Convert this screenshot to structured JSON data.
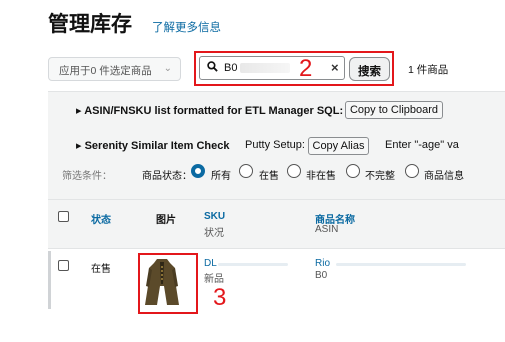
{
  "page": {
    "title": "管理库存",
    "learn_more": "了解更多信息"
  },
  "toolbar": {
    "bulk_action": "应用于0 件选定商品",
    "search_value": "B0",
    "search_button": "搜索",
    "result_count": "1 件商品"
  },
  "annotations": {
    "search_marker": "2",
    "image_marker": "3",
    "color": "#e3171b"
  },
  "tools": {
    "asin_list_label": "ASIN/FNSKU list formatted for ETL Manager SQL:",
    "copy_clipboard": "Copy to Clipboard",
    "serenity_label": "Serenity Similar Item Check",
    "putty_label": "Putty Setup:",
    "copy_alias": "Copy Alias",
    "age_hint": "Enter \"-age\" va"
  },
  "filters": {
    "label": "筛选条件：",
    "status_label": "商品状态：",
    "options": [
      "所有",
      "在售",
      "非在售",
      "不完整",
      "商品信息"
    ],
    "selected": "所有"
  },
  "table": {
    "headers": {
      "status": "状态",
      "image": "图片",
      "sku": "SKU",
      "condition": "状况",
      "name": "商品名称",
      "asin": "ASIN"
    },
    "rows": [
      {
        "status": "在售",
        "sku": "DL",
        "condition": "新品",
        "name": "Rio",
        "asin": "B0"
      }
    ]
  },
  "colors": {
    "link": "#0b6aa2",
    "panel": "#f3f4f4"
  }
}
